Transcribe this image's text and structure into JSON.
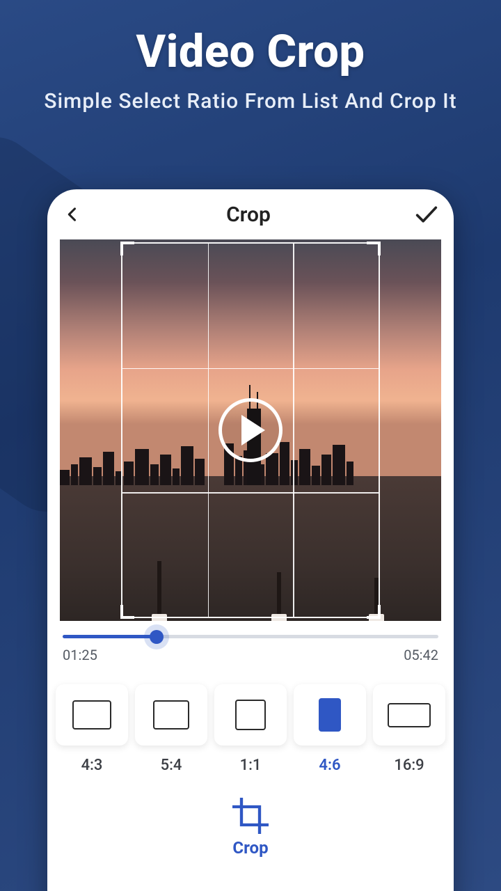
{
  "promo": {
    "title": "Video Crop",
    "subtitle": "Simple Select Ratio From List And Crop It"
  },
  "header": {
    "title": "Crop"
  },
  "player": {
    "current_time": "01:25",
    "total_time": "05:42",
    "progress_percent": 25
  },
  "ratios": [
    {
      "id": "4:3",
      "label": "4:3",
      "selected": false
    },
    {
      "id": "5:4",
      "label": "5:4",
      "selected": false
    },
    {
      "id": "1:1",
      "label": "1:1",
      "selected": false
    },
    {
      "id": "4:6",
      "label": "4:6",
      "selected": true
    },
    {
      "id": "16:9",
      "label": "16:9",
      "selected": false
    }
  ],
  "tool": {
    "label": "Crop"
  },
  "colors": {
    "accent": "#2f57c4"
  }
}
